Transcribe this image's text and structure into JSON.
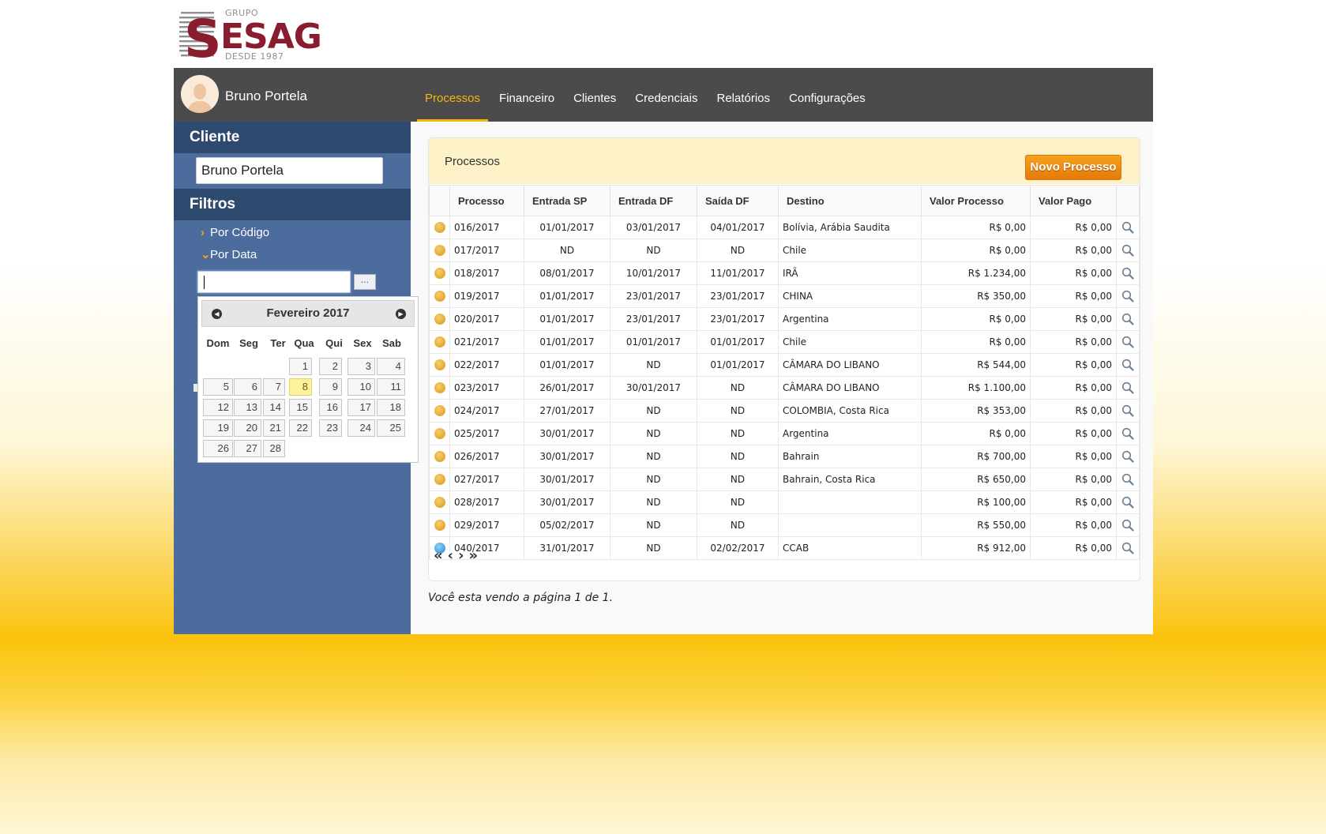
{
  "logo": {
    "grupo": "GRUPO",
    "brand": "ESAG",
    "desde": "DESDE 1987"
  },
  "header": {
    "username": "Bruno Portela"
  },
  "nav": [
    "Processos",
    "Financeiro",
    "Clientes",
    "Credenciais",
    "Relatórios",
    "Configurações"
  ],
  "sidebar": {
    "client_title": "Cliente",
    "client_value": "Bruno Portela",
    "filters_title": "Filtros",
    "filter_code": "Por Código",
    "filter_date": "Por Data",
    "date_button": "..."
  },
  "calendar": {
    "title": "Fevereiro 2017",
    "weekdays": [
      "Dom",
      "Seg",
      "Ter",
      "Qua",
      "Qui",
      "Sex",
      "Sab"
    ],
    "first_weekday": 3,
    "days": 28,
    "today": 8
  },
  "panel": {
    "title": "Processos",
    "new_button": "Novo Processo",
    "columns": [
      "Processo",
      "Entrada SP",
      "Entrada DF",
      "Saída DF",
      "Destino",
      "Valor Processo",
      "Valor Pago"
    ],
    "rows": [
      {
        "status": "orange",
        "processo": "016/2017",
        "entrada_sp": "01/01/2017",
        "entrada_df": "03/01/2017",
        "saida_df": "04/01/2017",
        "destino": "Bolívia, Arábia Saudita",
        "valor_processo": "R$ 0,00",
        "valor_pago": "R$ 0,00"
      },
      {
        "status": "orange",
        "processo": "017/2017",
        "entrada_sp": "ND",
        "entrada_df": "ND",
        "saida_df": "ND",
        "destino": "Chile",
        "valor_processo": "R$ 0,00",
        "valor_pago": "R$ 0,00"
      },
      {
        "status": "orange",
        "processo": "018/2017",
        "entrada_sp": "08/01/2017",
        "entrada_df": "10/01/2017",
        "saida_df": "11/01/2017",
        "destino": "IRÃ",
        "valor_processo": "R$ 1.234,00",
        "valor_pago": "R$ 0,00"
      },
      {
        "status": "orange",
        "processo": "019/2017",
        "entrada_sp": "01/01/2017",
        "entrada_df": "23/01/2017",
        "saida_df": "23/01/2017",
        "destino": "CHINA",
        "valor_processo": "R$ 350,00",
        "valor_pago": "R$ 0,00"
      },
      {
        "status": "orange",
        "processo": "020/2017",
        "entrada_sp": "01/01/2017",
        "entrada_df": "23/01/2017",
        "saida_df": "23/01/2017",
        "destino": "Argentina",
        "valor_processo": "R$ 0,00",
        "valor_pago": "R$ 0,00"
      },
      {
        "status": "orange",
        "processo": "021/2017",
        "entrada_sp": "01/01/2017",
        "entrada_df": "01/01/2017",
        "saida_df": "01/01/2017",
        "destino": "Chile",
        "valor_processo": "R$ 0,00",
        "valor_pago": "R$ 0,00"
      },
      {
        "status": "orange",
        "processo": "022/2017",
        "entrada_sp": "01/01/2017",
        "entrada_df": "ND",
        "saida_df": "01/01/2017",
        "destino": "CÂMARA DO LIBANO",
        "valor_processo": "R$ 544,00",
        "valor_pago": "R$ 0,00"
      },
      {
        "status": "orange",
        "processo": "023/2017",
        "entrada_sp": "26/01/2017",
        "entrada_df": "30/01/2017",
        "saida_df": "ND",
        "destino": "CÂMARA DO LIBANO",
        "valor_processo": "R$ 1.100,00",
        "valor_pago": "R$ 0,00"
      },
      {
        "status": "orange",
        "processo": "024/2017",
        "entrada_sp": "27/01/2017",
        "entrada_df": "ND",
        "saida_df": "ND",
        "destino": "COLOMBIA, Costa Rica",
        "valor_processo": "R$ 353,00",
        "valor_pago": "R$ 0,00"
      },
      {
        "status": "orange",
        "processo": "025/2017",
        "entrada_sp": "30/01/2017",
        "entrada_df": "ND",
        "saida_df": "ND",
        "destino": "Argentina",
        "valor_processo": "R$ 0,00",
        "valor_pago": "R$ 0,00"
      },
      {
        "status": "orange",
        "processo": "026/2017",
        "entrada_sp": "30/01/2017",
        "entrada_df": "ND",
        "saida_df": "ND",
        "destino": "Bahrain",
        "valor_processo": "R$ 700,00",
        "valor_pago": "R$ 0,00"
      },
      {
        "status": "orange",
        "processo": "027/2017",
        "entrada_sp": "30/01/2017",
        "entrada_df": "ND",
        "saida_df": "ND",
        "destino": "Bahrain, Costa Rica",
        "valor_processo": "R$ 650,00",
        "valor_pago": "R$ 0,00"
      },
      {
        "status": "orange",
        "processo": "028/2017",
        "entrada_sp": "30/01/2017",
        "entrada_df": "ND",
        "saida_df": "ND",
        "destino": "",
        "valor_processo": "R$ 100,00",
        "valor_pago": "R$ 0,00"
      },
      {
        "status": "orange",
        "processo": "029/2017",
        "entrada_sp": "05/02/2017",
        "entrada_df": "ND",
        "saida_df": "ND",
        "destino": "",
        "valor_processo": "R$ 550,00",
        "valor_pago": "R$ 0,00"
      },
      {
        "status": "blue",
        "processo": "040/2017",
        "entrada_sp": "31/01/2017",
        "entrada_df": "ND",
        "saida_df": "02/02/2017",
        "destino": "CCAB",
        "valor_processo": "R$ 912,00",
        "valor_pago": "R$ 0,00"
      }
    ],
    "pager": {
      "first": "«",
      "prev": "‹",
      "next": "›",
      "last": "»"
    }
  },
  "page_info": "Você esta vendo a página 1 de 1."
}
